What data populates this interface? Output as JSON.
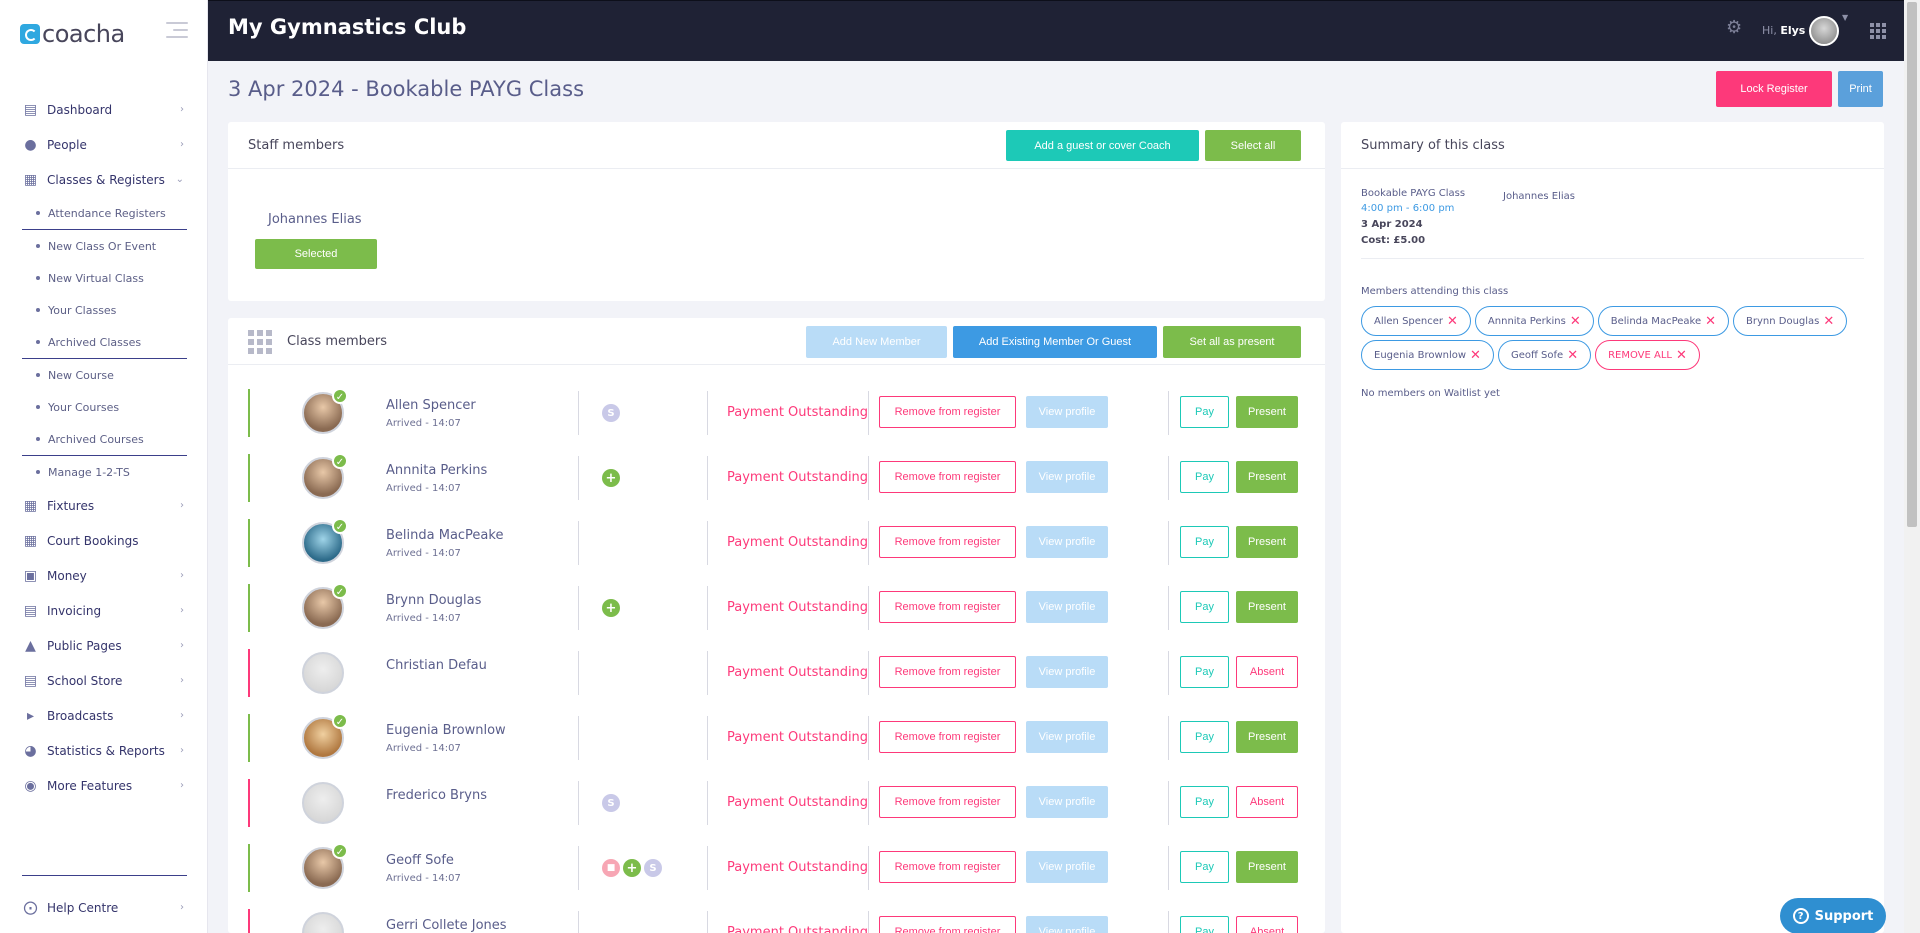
{
  "sidebar": {
    "logo": "coacha",
    "items": [
      {
        "label": "Dashboard",
        "icon": "chart-icon"
      },
      {
        "label": "People",
        "icon": "people-icon"
      },
      {
        "label": "Classes & Registers",
        "icon": "calendar-icon"
      },
      {
        "label": "Fixtures",
        "icon": "fixtures-icon"
      },
      {
        "label": "Court Bookings",
        "icon": "court-icon"
      },
      {
        "label": "Money",
        "icon": "money-icon"
      },
      {
        "label": "Invoicing",
        "icon": "invoice-icon"
      },
      {
        "label": "Public Pages",
        "icon": "sitemap-icon"
      },
      {
        "label": "School Store",
        "icon": "store-icon"
      },
      {
        "label": "Broadcasts",
        "icon": "megaphone-icon"
      },
      {
        "label": "Statistics & Reports",
        "icon": "pie-icon"
      },
      {
        "label": "More Features",
        "icon": "chevron-circle-icon"
      }
    ],
    "sub_items": [
      "Attendance Registers",
      "New Class Or Event",
      "New Virtual Class",
      "Your Classes",
      "Archived Classes",
      "New Course",
      "Your Courses",
      "Archived Courses",
      "Manage 1-2-TS"
    ],
    "help": "Help Centre"
  },
  "topbar": {
    "club_name": "My Gymnastics Club",
    "greeting": "Hi,",
    "user": "Elys"
  },
  "page": {
    "title": "3 Apr 2024 - Bookable PAYG Class",
    "lock_register": "Lock Register",
    "print": "Print"
  },
  "staff": {
    "title": "Staff members",
    "add_guest": "Add a guest or cover Coach",
    "select_all": "Select all",
    "name": "Johannes Elias",
    "selected": "Selected"
  },
  "members": {
    "title": "Class members",
    "add_new": "Add New Member",
    "add_existing": "Add Existing Member Or Guest",
    "set_all_present": "Set all as present",
    "remove_label": "Remove from register",
    "view_label": "View profile",
    "pay_label": "Pay",
    "rows": [
      {
        "name": "Allen Spencer",
        "arrived": "Arrived - 14:07",
        "payment": "Payment Outstanding",
        "status": "Present"
      },
      {
        "name": "Annnita Perkins",
        "arrived": "Arrived - 14:07",
        "payment": "Payment Outstanding",
        "status": "Present"
      },
      {
        "name": "Belinda MacPeake",
        "arrived": "Arrived - 14:07",
        "payment": "Payment Outstanding",
        "status": "Present"
      },
      {
        "name": "Brynn Douglas",
        "arrived": "Arrived - 14:07",
        "payment": "Payment Outstanding",
        "status": "Present"
      },
      {
        "name": "Christian Defau",
        "arrived": "",
        "payment": "Payment Outstanding",
        "status": "Absent"
      },
      {
        "name": "Eugenia Brownlow",
        "arrived": "Arrived - 14:07",
        "payment": "Payment Outstanding",
        "status": "Present"
      },
      {
        "name": "Frederico Bryns",
        "arrived": "",
        "payment": "Payment Outstanding",
        "status": "Absent"
      },
      {
        "name": "Geoff Sofe",
        "arrived": "Arrived - 14:07",
        "payment": "Payment Outstanding",
        "status": "Present"
      },
      {
        "name": "Gerri Collete Jones",
        "arrived": "",
        "payment": "Payment Outstanding",
        "status": "Absent"
      }
    ]
  },
  "summary": {
    "title": "Summary of this class",
    "class_name": "Bookable PAYG Class",
    "time": "4:00 pm - 6:00 pm",
    "date": "3 Apr 2024",
    "cost": "Cost: £5.00",
    "coach": "Johannes Elias",
    "attending_label": "Members attending this class",
    "attending": [
      "Allen Spencer",
      "Annnita Perkins",
      "Belinda MacPeake",
      "Brynn Douglas",
      "Eugenia Brownlow",
      "Geoff Sofe"
    ],
    "remove_all": "REMOVE ALL",
    "waitlist": "No members on Waitlist yet"
  },
  "support": "Support",
  "colors": {
    "accent_green": "#7cbc4b",
    "accent_pink": "#fd397a",
    "accent_blue": "#3d9ae3",
    "accent_teal": "#1dc9b7",
    "topbar": "#1f2235"
  }
}
